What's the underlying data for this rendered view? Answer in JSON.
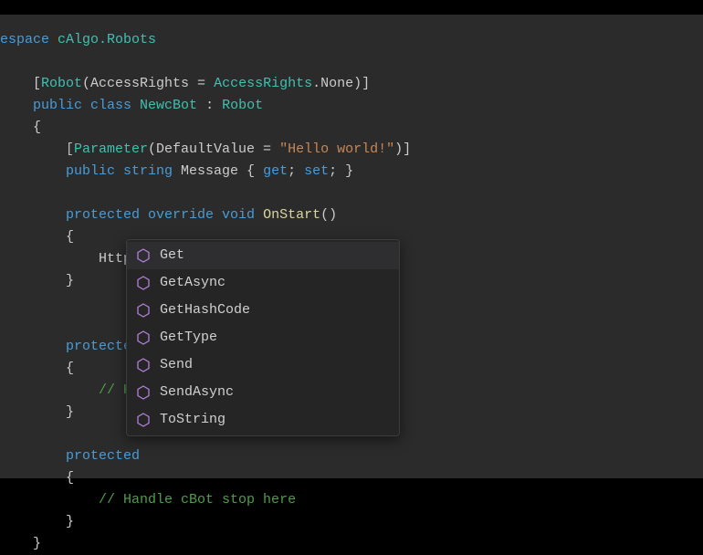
{
  "code": {
    "l1_kw": "espace",
    "l1_type": " cAlgo.Robots",
    "l2_a": "    [",
    "l2_b": "Robot",
    "l2_c": "(AccessRights = ",
    "l2_d": "AccessRights",
    "l2_e": ".None)]",
    "l3_a": "    ",
    "l3_b": "public class ",
    "l3_c": "NewcBot",
    "l3_d": " : ",
    "l3_e": "Robot",
    "l4": "    {",
    "l5_a": "        [",
    "l5_b": "Parameter",
    "l5_c": "(DefaultValue = ",
    "l5_d": "\"Hello world!\"",
    "l5_e": ")]",
    "l6_a": "        ",
    "l6_b": "public string",
    "l6_c": " Message { ",
    "l6_d": "get",
    "l6_e": "; ",
    "l6_f": "set",
    "l6_g": "; }",
    "l8_a": "        ",
    "l8_b": "protected override void ",
    "l8_c": "OnStart",
    "l8_d": "()",
    "l9": "        {",
    "l10_a": "            Http.",
    "l11": "        }",
    "l14_a": "        ",
    "l14_b": "protected",
    "l15": "        {",
    "l16_a": "            ",
    "l16_b": "// Ha",
    "l17": "        }",
    "l19_a": "        ",
    "l19_b": "protected",
    "l20": "        {",
    "l21_a": "            ",
    "l21_b": "// Handle cBot stop here",
    "l22": "        }",
    "l23": "    }"
  },
  "autocomplete": {
    "items": [
      {
        "label": "Get"
      },
      {
        "label": "GetAsync"
      },
      {
        "label": "GetHashCode"
      },
      {
        "label": "GetType"
      },
      {
        "label": "Send"
      },
      {
        "label": "SendAsync"
      },
      {
        "label": "ToString"
      }
    ]
  }
}
